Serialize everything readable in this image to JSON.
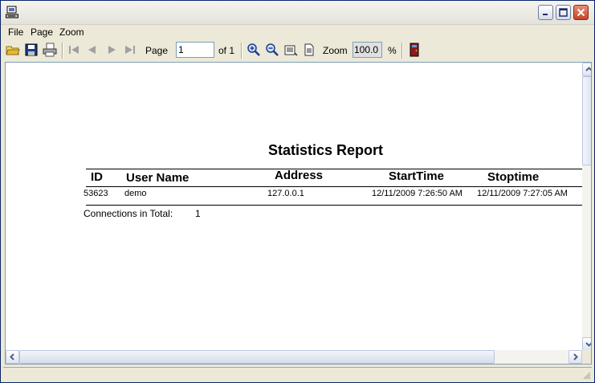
{
  "window": {
    "title": ""
  },
  "menu": {
    "file": "File",
    "page": "Page",
    "zoom": "Zoom"
  },
  "toolbar": {
    "page_label": "Page",
    "page_value": "1",
    "of_label": "of 1",
    "zoom_label": "Zoom",
    "zoom_value": "100.0",
    "percent": "%"
  },
  "report": {
    "title": "Statistics Report",
    "columns": [
      "ID",
      "User Name",
      "Address",
      "StartTime",
      "Stoptime"
    ],
    "rows": [
      {
        "id": "53623",
        "user": "demo",
        "address": "127.0.0.1",
        "start": "12/11/2009 7:26:50 AM",
        "stop": "12/11/2009 7:27:05 AM"
      }
    ],
    "total_label": "Connections in Total:",
    "total_value": "1"
  },
  "colors": {
    "accent": "#0a246a",
    "chrome": "#ece9d8",
    "close": "#c4442a"
  }
}
